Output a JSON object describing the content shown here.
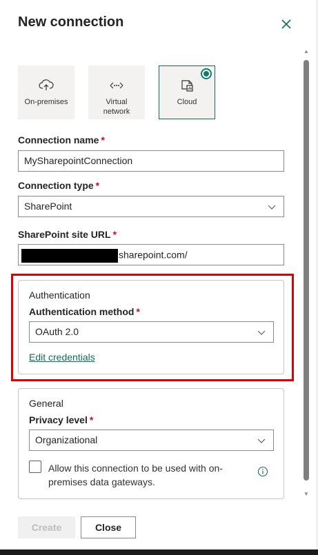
{
  "dialog": {
    "title": "New connection"
  },
  "tiles": [
    {
      "label": "On-premises",
      "icon": "cloud-upload-icon"
    },
    {
      "label": "Virtual network",
      "icon": "network-arrows-icon"
    },
    {
      "label": "Cloud",
      "icon": "cloud-chart-icon",
      "selected": true
    }
  ],
  "fields": {
    "connection_name": {
      "label": "Connection name",
      "required": "*",
      "value": "MySharepointConnection"
    },
    "connection_type": {
      "label": "Connection type",
      "required": "*",
      "value": "SharePoint"
    },
    "site_url": {
      "label": "SharePoint site URL",
      "required": "*",
      "value": "sharepoint.com/"
    }
  },
  "authentication": {
    "title": "Authentication",
    "method_label": "Authentication method",
    "required": "*",
    "method_value": "OAuth 2.0",
    "edit_link": "Edit credentials"
  },
  "general": {
    "title": "General",
    "privacy_label": "Privacy level",
    "required": "*",
    "privacy_value": "Organizational",
    "gateway_checkbox_label": "Allow this connection to be used with on-premises data gateways."
  },
  "buttons": {
    "create": "Create",
    "close": "Close"
  },
  "colors": {
    "accent": "#0f6c5b",
    "required": "#c50f1f",
    "highlight": "#e00000"
  }
}
